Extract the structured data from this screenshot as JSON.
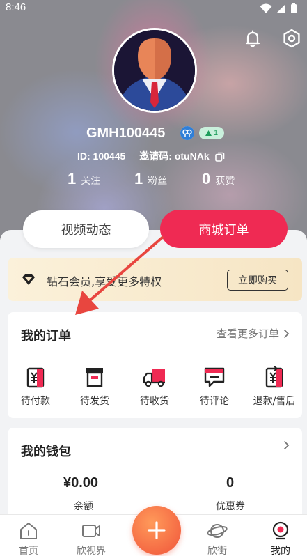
{
  "status_bar": {
    "time": "8:46"
  },
  "profile": {
    "username": "GMH100445",
    "level": "1",
    "id_text": "ID: 100445",
    "invite_text": "邀请码: otuNAk",
    "stats": [
      {
        "value": "1",
        "label": "关注"
      },
      {
        "value": "1",
        "label": "粉丝"
      },
      {
        "value": "0",
        "label": "获赞"
      }
    ]
  },
  "tabs": {
    "video": "视频动态",
    "orders": "商城订单"
  },
  "vip": {
    "text": "钻石会员,享受更多特权",
    "button": "立即购买"
  },
  "orders": {
    "title": "我的订单",
    "more": "查看更多订单",
    "items": [
      {
        "label": "待付款",
        "icon": "pending-payment-icon"
      },
      {
        "label": "待发货",
        "icon": "pending-shipment-icon"
      },
      {
        "label": "待收货",
        "icon": "pending-delivery-icon"
      },
      {
        "label": "待评论",
        "icon": "pending-review-icon"
      },
      {
        "label": "退款/售后",
        "icon": "refund-icon"
      }
    ]
  },
  "wallet": {
    "title": "我的钱包",
    "balance_value": "¥0.00",
    "balance_label": "余额",
    "coupon_value": "0",
    "coupon_label": "优惠券"
  },
  "nav": {
    "home": "首页",
    "vision": "欣视界",
    "street": "欣街",
    "mine": "我的"
  },
  "colors": {
    "accent": "#ef2a53",
    "fab": "#f0543a",
    "vip_bg": "#f6e5c4"
  }
}
